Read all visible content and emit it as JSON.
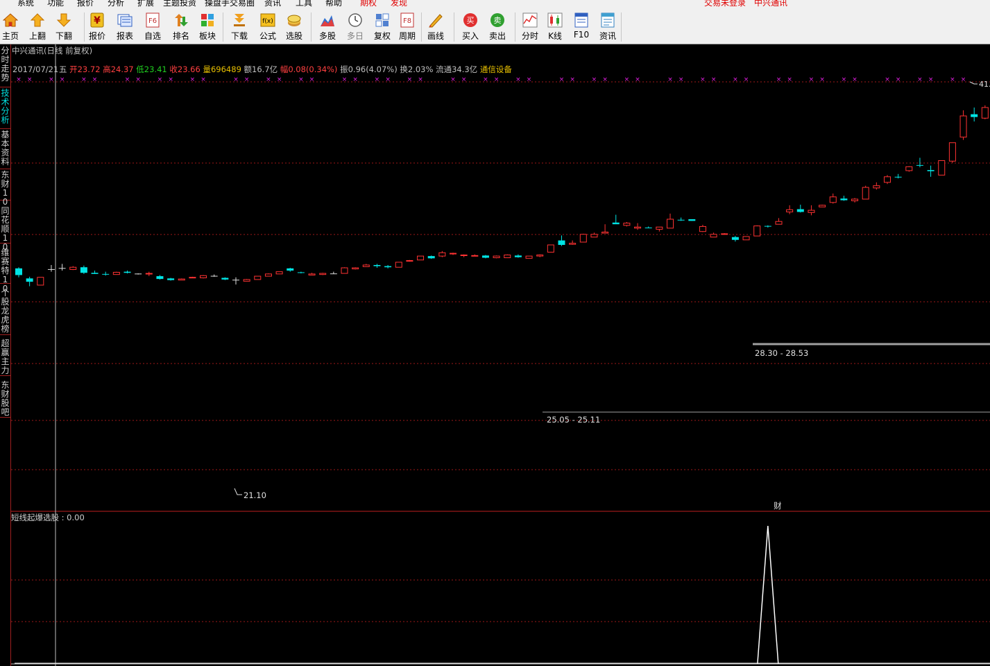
{
  "menu": {
    "items": [
      "系统",
      "功能",
      "报价",
      "分析",
      "扩展",
      "主题投资",
      "操盘手交易圈",
      "资讯",
      "工具",
      "帮助"
    ],
    "special": [
      "期权",
      "发现"
    ],
    "login_status": "交易未登录",
    "stock_title": "中兴通讯"
  },
  "toolbar": {
    "buttons": [
      {
        "label": "主页",
        "icon": "home-icon"
      },
      {
        "label": "上翻",
        "icon": "arrow-up-icon"
      },
      {
        "label": "下翻",
        "icon": "arrow-down-icon"
      },
      {
        "label": "报价",
        "icon": "yen-icon"
      },
      {
        "label": "报表",
        "icon": "report-icon"
      },
      {
        "label": "自选",
        "icon": "f6-icon"
      },
      {
        "label": "排名",
        "icon": "ranking-icon"
      },
      {
        "label": "板块",
        "icon": "sector-grid-icon"
      },
      {
        "label": "下载",
        "icon": "download-icon"
      },
      {
        "label": "公式",
        "icon": "formula-icon"
      },
      {
        "label": "选股",
        "icon": "stock-picker-icon"
      },
      {
        "label": "多股",
        "icon": "multi-stock-icon"
      },
      {
        "label": "多日",
        "icon": "clock-icon"
      },
      {
        "label": "复权",
        "icon": "adjust-icon"
      },
      {
        "label": "周期",
        "icon": "f8-icon"
      },
      {
        "label": "画线",
        "icon": "draw-line-icon"
      },
      {
        "label": "买入",
        "icon": "buy-icon"
      },
      {
        "label": "卖出",
        "icon": "sell-icon"
      },
      {
        "label": "分时",
        "icon": "intraday-icon"
      },
      {
        "label": "K线",
        "icon": "kline-icon"
      },
      {
        "label": "F10",
        "icon": "f10-icon"
      },
      {
        "label": "资讯",
        "icon": "news-icon"
      }
    ],
    "icon_texts": {
      "yen": "¥",
      "f6": "F6",
      "fx": "f(x)",
      "f8": "F8",
      "buy": "买",
      "sell": "卖"
    }
  },
  "left_tabs": [
    {
      "label": "分时走势",
      "active": false
    },
    {
      "label": "技术分析",
      "active": true
    },
    {
      "label": "基本资料",
      "active": false
    },
    {
      "label": "东财10",
      "active": false
    },
    {
      "label": "同花顺10",
      "active": false
    },
    {
      "label": "维赛特10",
      "active": false
    },
    {
      "label": "个股龙虎榜",
      "active": false
    },
    {
      "label": "超赢主力",
      "active": false
    },
    {
      "label": "东财股吧",
      "active": false
    }
  ],
  "chart_header": {
    "title": "中兴通讯(日线 前复权)",
    "date": "2017/07/21",
    "weekday": "五",
    "open_label": "开",
    "open": "23.72",
    "high_label": "高",
    "high": "24.37",
    "low_label": "低",
    "low": "23.41",
    "close_label": "收",
    "close": "23.66",
    "volume_label": "量",
    "volume": "696489",
    "amount_label": "额",
    "amount": "16.7亿",
    "change_label": "幅",
    "change": "0.08(0.34%)",
    "amplitude_label": "振",
    "amplitude": "0.96(4.07%)",
    "turnover_label": "换",
    "turnover": "2.03%",
    "float_label": "流通",
    "float_cap": "34.3亿",
    "industry": "通信设备"
  },
  "annotations": {
    "support1": "25.05 - 25.11",
    "support2": "28.30 - 28.53",
    "min_low": "21.10",
    "max_high": "41.",
    "event_marker": "财"
  },
  "indicator": {
    "label": "短线起爆选股 : 0.00",
    "value": 0.0
  },
  "colors": {
    "up": "#ff3232",
    "down": "#00e4e4",
    "flat": "#e0e0e0",
    "grid": "#a01818",
    "crosshair": "#c0c0c0",
    "magenta": "#e020e0",
    "support_line": "#a0a0a0"
  },
  "chart_data": {
    "type": "candlestick",
    "title": "中兴通讯(日线 前复权)",
    "ohlc": [
      [
        23.8,
        23.9,
        23.0,
        23.2
      ],
      [
        22.9,
        23.05,
        22.2,
        22.6
      ],
      [
        22.3,
        23.0,
        22.3,
        23.0
      ],
      [
        23.7,
        24.1,
        23.5,
        23.7
      ],
      [
        23.8,
        24.2,
        23.6,
        23.8
      ],
      [
        23.7,
        24.0,
        23.65,
        23.9
      ],
      [
        23.9,
        24.05,
        23.3,
        23.4
      ],
      [
        23.4,
        23.6,
        23.3,
        23.3
      ],
      [
        23.3,
        23.5,
        23.15,
        23.25
      ],
      [
        23.25,
        23.5,
        23.25,
        23.45
      ],
      [
        23.5,
        23.6,
        23.35,
        23.4
      ],
      [
        23.3,
        23.35,
        23.25,
        23.3
      ],
      [
        23.3,
        23.5,
        23.1,
        23.35
      ],
      [
        23.1,
        23.2,
        22.8,
        22.85
      ],
      [
        22.9,
        22.95,
        22.7,
        22.75
      ],
      [
        22.75,
        22.9,
        22.75,
        22.85
      ],
      [
        22.95,
        23.05,
        22.95,
        23.0
      ],
      [
        22.95,
        23.2,
        22.9,
        23.15
      ],
      [
        23.1,
        23.25,
        23.05,
        23.1
      ],
      [
        22.95,
        23.0,
        22.75,
        22.8
      ],
      [
        22.75,
        23.0,
        22.35,
        22.75
      ],
      [
        22.65,
        22.85,
        22.65,
        22.8
      ],
      [
        22.8,
        23.1,
        22.8,
        23.1
      ],
      [
        23.1,
        23.35,
        23.1,
        23.3
      ],
      [
        23.3,
        23.5,
        23.3,
        23.5
      ],
      [
        23.8,
        23.85,
        23.5,
        23.6
      ],
      [
        23.45,
        23.5,
        23.35,
        23.4
      ],
      [
        23.2,
        23.4,
        23.2,
        23.3
      ],
      [
        23.25,
        23.4,
        23.2,
        23.35
      ],
      [
        23.3,
        23.5,
        23.3,
        23.31
      ],
      [
        23.35,
        23.9,
        23.35,
        23.85
      ],
      [
        23.75,
        23.9,
        23.7,
        23.85
      ],
      [
        23.95,
        24.2,
        23.95,
        24.1
      ],
      [
        24.1,
        24.2,
        23.85,
        24.0
      ],
      [
        24.0,
        24.1,
        23.8,
        23.9
      ],
      [
        23.9,
        24.35,
        23.9,
        24.35
      ],
      [
        24.45,
        24.55,
        24.4,
        24.5
      ],
      [
        24.55,
        24.9,
        24.55,
        24.9
      ],
      [
        24.9,
        24.95,
        24.65,
        24.7
      ],
      [
        24.9,
        25.35,
        24.8,
        25.2
      ],
      [
        25.1,
        25.2,
        25.0,
        25.15
      ],
      [
        24.95,
        25.05,
        24.8,
        25.0
      ],
      [
        24.9,
        25.05,
        24.9,
        24.95
      ],
      [
        24.95,
        25.0,
        24.7,
        24.75
      ],
      [
        24.75,
        24.95,
        24.7,
        24.9
      ],
      [
        24.75,
        25.05,
        24.75,
        25.0
      ],
      [
        24.95,
        25.05,
        24.75,
        24.8
      ],
      [
        24.7,
        24.9,
        24.7,
        24.9
      ],
      [
        24.9,
        25.05,
        24.8,
        25.0
      ],
      [
        25.25,
        25.9,
        25.25,
        25.9
      ],
      [
        26.3,
        26.75,
        25.8,
        25.9
      ],
      [
        25.95,
        26.3,
        25.9,
        26.05
      ],
      [
        26.15,
        26.9,
        26.15,
        26.85
      ],
      [
        26.6,
        27.0,
        26.6,
        26.85
      ],
      [
        26.95,
        27.75,
        26.95,
        27.05
      ],
      [
        27.9,
        28.6,
        27.8,
        27.75
      ],
      [
        27.65,
        27.95,
        27.55,
        27.85
      ],
      [
        27.4,
        27.85,
        27.25,
        27.5
      ],
      [
        27.45,
        27.55,
        27.4,
        27.4
      ],
      [
        27.3,
        27.5,
        27.1,
        27.5
      ],
      [
        27.4,
        28.7,
        27.4,
        28.2
      ],
      [
        28.15,
        28.35,
        28.05,
        28.1
      ],
      [
        28.2,
        28.2,
        28.05,
        28.05
      ],
      [
        27.1,
        27.7,
        27.05,
        27.55
      ],
      [
        26.6,
        27.0,
        26.6,
        26.85
      ],
      [
        26.85,
        26.95,
        26.8,
        26.9
      ],
      [
        26.6,
        26.7,
        26.2,
        26.35
      ],
      [
        26.35,
        26.65,
        26.35,
        26.65
      ],
      [
        26.7,
        27.65,
        26.7,
        27.6
      ],
      [
        27.6,
        27.65,
        27.45,
        27.55
      ],
      [
        27.75,
        28.3,
        27.75,
        28.0
      ],
      [
        28.85,
        29.45,
        28.65,
        29.05
      ],
      [
        29.1,
        29.5,
        28.8,
        28.85
      ],
      [
        28.8,
        29.45,
        28.55,
        29.0
      ],
      [
        29.3,
        29.5,
        29.3,
        29.45
      ],
      [
        29.7,
        30.5,
        29.6,
        30.2
      ],
      [
        30.05,
        30.3,
        29.85,
        29.9
      ],
      [
        29.85,
        30.1,
        29.7,
        30.0
      ],
      [
        30.0,
        31.2,
        30.0,
        31.05
      ],
      [
        31.0,
        31.5,
        30.85,
        31.2
      ],
      [
        31.5,
        32.15,
        31.35,
        32.0
      ],
      [
        32.0,
        32.25,
        31.85,
        31.95
      ],
      [
        32.55,
        32.95,
        32.45,
        32.9
      ],
      [
        33.05,
        33.7,
        32.85,
        33.0
      ],
      [
        32.6,
        33.0,
        32.0,
        32.5
      ],
      [
        32.15,
        33.35,
        32.15,
        33.45
      ],
      [
        33.4,
        35.05,
        33.25,
        35.05
      ],
      [
        35.55,
        37.95,
        35.3,
        37.45
      ],
      [
        37.6,
        38.2,
        36.95,
        37.35
      ],
      [
        37.25,
        38.4,
        37.15,
        38.2
      ],
      [
        38.55,
        41.3,
        38.2,
        41.05
      ],
      [
        41.05,
        41.45,
        40.8,
        41.0
      ]
    ],
    "indicator_series": {
      "name": "短线起爆选股",
      "spike_bar_index": 69,
      "spike_value": 1,
      "other_values": 0
    },
    "annotations": [
      "25.05 - 25.11",
      "28.30 - 28.53",
      "21.10",
      "41.",
      "财"
    ],
    "grid": true
  }
}
